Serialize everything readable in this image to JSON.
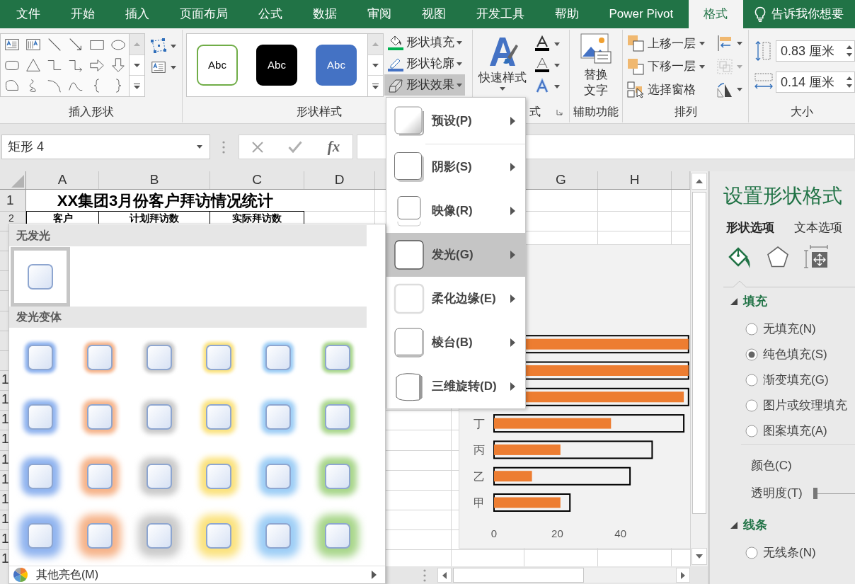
{
  "ribbon_tabs": [
    {
      "label": "文件",
      "selected": false
    },
    {
      "label": "开始",
      "selected": false
    },
    {
      "label": "插入",
      "selected": false
    },
    {
      "label": "页面布局",
      "selected": false
    },
    {
      "label": "公式",
      "selected": false
    },
    {
      "label": "数据",
      "selected": false
    },
    {
      "label": "审阅",
      "selected": false
    },
    {
      "label": "视图",
      "selected": false
    },
    {
      "label": "开发工具",
      "selected": false
    },
    {
      "label": "帮助",
      "selected": false
    },
    {
      "label": "Power Pivot",
      "selected": false
    },
    {
      "label": "格式",
      "selected": true
    }
  ],
  "tell_me": {
    "text": "告诉我你想要"
  },
  "ribbon": {
    "insert_shapes": {
      "label": "插入形状"
    },
    "shape_styles": {
      "label": "形状样式",
      "samples": [
        {
          "text": "Abc",
          "kind": "outline",
          "color": "#70ad47"
        },
        {
          "text": "Abc",
          "kind": "fill",
          "color": "#000000"
        },
        {
          "text": "Abc",
          "kind": "fill",
          "color": "#4472c4"
        }
      ],
      "commands": [
        {
          "label": "形状填充",
          "kind": "fill",
          "expanded": false
        },
        {
          "label": "形状轮廓",
          "kind": "outline",
          "expanded": false
        },
        {
          "label": "形状效果",
          "kind": "effects",
          "expanded": true
        }
      ]
    },
    "wordart_styles": {
      "label": "式",
      "quick_styles": "快速样式"
    },
    "accessibility": {
      "label": "辅助功能",
      "alt_text": "替换文字"
    },
    "arrange": {
      "label": "排列",
      "commands": [
        {
          "label": "上移一层",
          "kind": "forward"
        },
        {
          "label": "下移一层",
          "kind": "backward"
        },
        {
          "label": "选择窗格",
          "kind": "pane"
        }
      ],
      "tools": [
        {
          "kind": "align",
          "disabled": false
        },
        {
          "kind": "group",
          "disabled": true
        },
        {
          "kind": "rotate",
          "disabled": false
        }
      ]
    },
    "size": {
      "label": "大小",
      "fields": [
        {
          "kind": "height",
          "value": "0.83 厘米"
        },
        {
          "kind": "width",
          "value": "0.14 厘米"
        }
      ]
    }
  },
  "formula_bar": {
    "name_box": "矩形 4",
    "function_label": "fx"
  },
  "sheet": {
    "columns": [
      {
        "label": "A"
      },
      {
        "label": "B"
      },
      {
        "label": "C"
      },
      {
        "label": "D"
      },
      {
        "label": "G"
      },
      {
        "label": "H"
      }
    ],
    "rows": [
      {
        "header": "1",
        "kind": "title",
        "cells": [
          {
            "text": "XX集团3月份客户拜访情况统计"
          }
        ]
      },
      {
        "header": "2",
        "kind": "heading",
        "cells": [
          {
            "text": "客户"
          },
          {
            "text": "计划拜访数"
          },
          {
            "text": "实际拜访数"
          }
        ]
      }
    ],
    "row_header_fragments": [
      {
        "label": "1"
      },
      {
        "label": "1"
      },
      {
        "label": "1"
      },
      {
        "label": "1"
      },
      {
        "label": "1"
      },
      {
        "label": "1"
      },
      {
        "label": "1"
      },
      {
        "label": "1"
      },
      {
        "label": "1"
      },
      {
        "label": "1"
      }
    ],
    "chart": {
      "chart_data": {
        "type": "bar",
        "orientation": "horizontal",
        "categories": [
          null,
          null,
          null,
          "丁",
          "丙",
          "乙",
          "甲"
        ],
        "series": [
          {
            "color": "#000000",
            "values": [
              61.5,
              61.5,
              61.5,
              60,
              50,
              43,
              24
            ]
          },
          {
            "color": "#ed7d31",
            "values": [
              61.5,
              61.5,
              60,
              37,
              21,
              12,
              21
            ]
          }
        ],
        "xlim": [
          0,
          62
        ],
        "xticks": [
          0,
          20,
          40
        ]
      }
    }
  },
  "effects_menu": {
    "items": [
      {
        "label": "预设(P)",
        "kind": "preset",
        "selected": false
      },
      {
        "label": "阴影(S)",
        "kind": "shadow",
        "selected": false
      },
      {
        "label": "映像(R)",
        "kind": "reflection",
        "selected": false
      },
      {
        "label": "发光(G)",
        "kind": "glow",
        "selected": true
      },
      {
        "label": "柔化边缘(E)",
        "kind": "soft_edges",
        "selected": false
      },
      {
        "label": "棱台(B)",
        "kind": "bevel",
        "selected": false
      },
      {
        "label": "三维旋转(D)",
        "kind": "rotation",
        "selected": false
      }
    ]
  },
  "glow_menu": {
    "none_title": "无发光",
    "none_option": {
      "selected": true
    },
    "variants_title": "发光变体",
    "variants": [
      [
        {
          "color": "#8fb3ef",
          "selected": false
        },
        {
          "color": "#f6b389",
          "selected": false
        },
        {
          "color": "#cacaca",
          "selected": false
        },
        {
          "color": "#fbe27e",
          "selected": false
        },
        {
          "color": "#9ccdf6",
          "selected": false
        },
        {
          "color": "#a8d68a",
          "selected": false
        }
      ],
      [
        {
          "color": "#8fb3ef",
          "selected": false
        },
        {
          "color": "#f6b389",
          "selected": false
        },
        {
          "color": "#cacaca",
          "selected": false
        },
        {
          "color": "#fbe27e",
          "selected": false
        },
        {
          "color": "#9ccdf6",
          "selected": false
        },
        {
          "color": "#a8d68a",
          "selected": false
        }
      ],
      [
        {
          "color": "#8fb3ef",
          "selected": false
        },
        {
          "color": "#f6b389",
          "selected": false
        },
        {
          "color": "#cacaca",
          "selected": false
        },
        {
          "color": "#fbe27e",
          "selected": false
        },
        {
          "color": "#9ccdf6",
          "selected": false
        },
        {
          "color": "#a8d68a",
          "selected": false
        }
      ],
      [
        {
          "color": "#8fb3ef",
          "selected": false
        },
        {
          "color": "#f6b389",
          "selected": false
        },
        {
          "color": "#cacaca",
          "selected": false
        },
        {
          "color": "#fbe27e",
          "selected": false
        },
        {
          "color": "#9ccdf6",
          "selected": false
        },
        {
          "color": "#a8d68a",
          "selected": false
        }
      ]
    ],
    "more": {
      "label": "其他亮色(M)"
    }
  },
  "format_pane": {
    "title": "设置形状格式",
    "tabs": [
      {
        "label": "形状选项",
        "selected": true
      },
      {
        "label": "文本选项",
        "selected": false
      }
    ],
    "icon_tabs": [
      {
        "kind": "fill",
        "selected": true
      },
      {
        "kind": "effects",
        "selected": false
      },
      {
        "kind": "size",
        "selected": false
      }
    ],
    "sections": [
      {
        "title": "填充",
        "expanded": true,
        "options": [
          {
            "label": "无填充(N)",
            "selected": false
          },
          {
            "label": "纯色填充(S)",
            "selected": true
          },
          {
            "label": "渐变填充(G)",
            "selected": false
          },
          {
            "label": "图片或纹理填充",
            "selected": false
          },
          {
            "label": "图案填充(A)",
            "selected": false
          }
        ],
        "properties": [
          {
            "label": "颜色(C)",
            "kind": "color"
          },
          {
            "label": "透明度(T)",
            "kind": "slider",
            "level": 0
          }
        ]
      },
      {
        "title": "线条",
        "expanded": true,
        "options": [
          {
            "label": "无线条(N)",
            "selected": false
          }
        ]
      }
    ]
  }
}
